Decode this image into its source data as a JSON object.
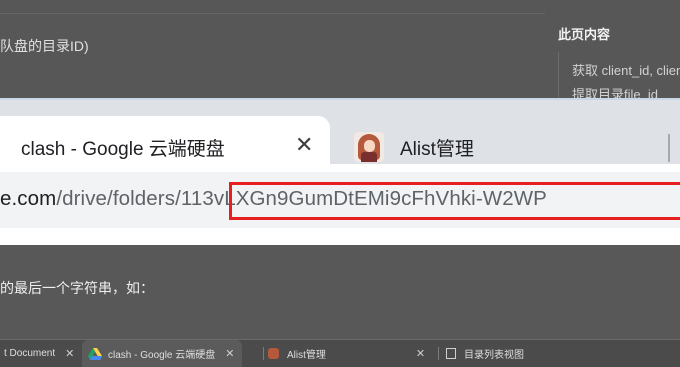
{
  "background_doc": {
    "top_text": "队盘的目录ID)",
    "toc_title": "此页内容",
    "toc_items": [
      "获取 client_id, client",
      "提取目录file_id"
    ],
    "bottom_text": "的最后一个字符串，如："
  },
  "browser": {
    "tabs": [
      {
        "label": "clash - Google 云端硬盘",
        "close": "✕"
      },
      {
        "label": "Alist管理"
      }
    ],
    "url": {
      "host": "e.com",
      "path": "/drive/folders/",
      "folder_id": "113vLXGn9GumDtEMi9cFhVhki-W2WP"
    }
  },
  "mini_tabs": [
    {
      "label": "t Document",
      "close": "✕"
    },
    {
      "label": "clash - Google 云端硬盘",
      "close": "✕"
    },
    {
      "label": "Alist管理",
      "close": "✕"
    },
    {
      "label": "目录列表视图"
    }
  ],
  "colors": {
    "highlight": "#e81f1f",
    "tabstrip": "#dee1e6",
    "drive_green": "#1fa463",
    "drive_yellow": "#ffd04b",
    "drive_blue": "#4688f4"
  },
  "icons": [
    "close-icon",
    "google-drive-icon",
    "alist-anime-icon"
  ]
}
